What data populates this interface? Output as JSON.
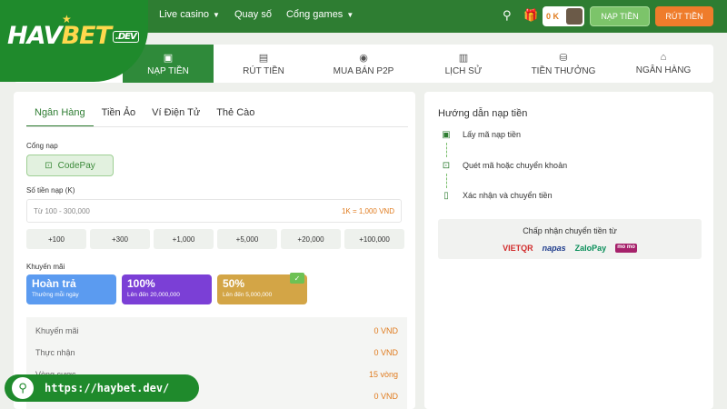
{
  "header": {
    "logo": {
      "hav": "HAV",
      "bet": "BET",
      "dev": ".DEV"
    },
    "nav": [
      {
        "label": "Live casino",
        "caret": true
      },
      {
        "label": "Quay số",
        "caret": false
      },
      {
        "label": "Cổng games",
        "caret": true
      }
    ],
    "ok_label": "0 K",
    "deposit_button": "NẠP TIỀN",
    "withdraw_button": "RÚT TIỀN"
  },
  "tabs": [
    {
      "label": "NẠP TIỀN",
      "icon": "wallet-icon",
      "active": true
    },
    {
      "label": "RÚT TIỀN",
      "icon": "cash-icon",
      "active": false
    },
    {
      "label": "MUA BÁN P2P",
      "icon": "coin-exchange-icon",
      "active": false
    },
    {
      "label": "LỊCH SỬ",
      "icon": "history-icon",
      "active": false
    },
    {
      "label": "TIỀN THƯỞNG",
      "icon": "bonus-coins-icon",
      "active": false
    },
    {
      "label": "NGÂN HÀNG",
      "icon": "bank-icon",
      "active": false
    }
  ],
  "deposit": {
    "subtabs": [
      {
        "label": "Ngân Hàng",
        "active": true
      },
      {
        "label": "Tiền Ảo",
        "active": false
      },
      {
        "label": "Ví Điện Tử",
        "active": false
      },
      {
        "label": "Thẻ Cào",
        "active": false
      }
    ],
    "gateway_label": "Cổng nạp",
    "gateway_option": "CodePay",
    "amount_label": "Số tiền nạp (K)",
    "amount_placeholder": "Từ 100 - 300,000",
    "amount_rate": "1K = 1,000 VND",
    "quick_amounts": [
      "+100",
      "+300",
      "+1,000",
      "+5,000",
      "+20,000",
      "+100,000"
    ],
    "promo_label": "Khuyến mãi",
    "promos": [
      {
        "title": "Hoàn trả",
        "subtitle": "Thưởng mỗi ngày",
        "color": "#5b9bf0",
        "selected": false
      },
      {
        "title": "100%",
        "subtitle": "Lên đến 20,000,000",
        "color": "#7b3fd6",
        "selected": false
      },
      {
        "title": "50%",
        "subtitle": "Lên đến 5,000,000",
        "color": "#d3a546",
        "selected": true
      }
    ],
    "summary": [
      {
        "label": "Khuyến mãi",
        "value": "0 VND"
      },
      {
        "label": "Thực nhận",
        "value": "0 VND"
      },
      {
        "label": "Vòng cược",
        "value": "15 vòng"
      },
      {
        "label": "",
        "value": "0 VND"
      }
    ]
  },
  "guide": {
    "title": "Hướng dẫn nạp tiền",
    "steps": [
      {
        "label": "Lấy mã nạp tiền",
        "icon": "clipboard-check-icon"
      },
      {
        "label": "Quét mã hoặc chuyển khoản",
        "icon": "qr-scan-icon"
      },
      {
        "label": "Xác nhận và chuyển tiền",
        "icon": "phone-confirm-icon"
      }
    ],
    "accept_title": "Chấp nhận chuyển tiền từ",
    "payment_logos": [
      "VIETQR",
      "napas",
      "ZaloPay",
      "mo mo"
    ]
  },
  "url": "https://haybet.dev/"
}
